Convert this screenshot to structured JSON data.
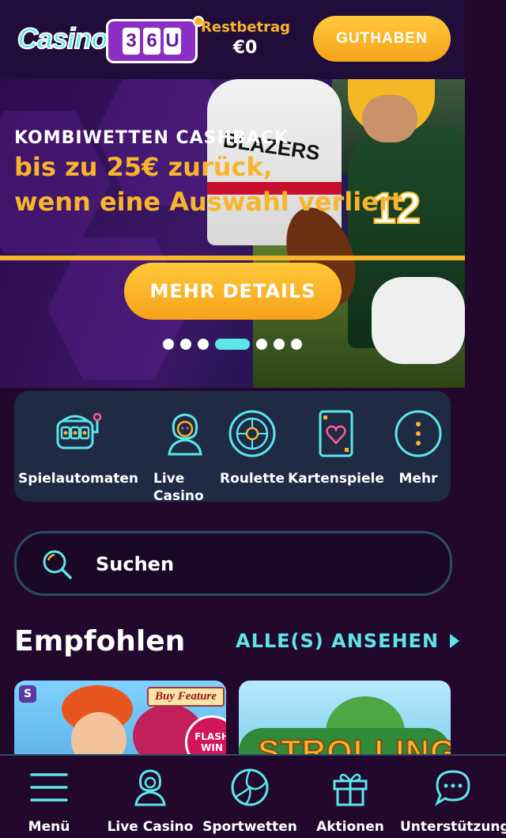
{
  "header": {
    "logo_text": "Casino",
    "logo_reels": [
      "3",
      "6",
      "U"
    ],
    "balance_label": "Restbetrag",
    "balance_value": "€0",
    "deposit_button": "GUTHABEN"
  },
  "banner": {
    "kicker": "KOMBIWETTEN CASHBACK",
    "headline_line1": "bis zu 25€ zurück,",
    "headline_line2": "wenn eine Auswahl verliert",
    "cta": "MEHR DETAILS",
    "slides_total": 7,
    "active_slide": 4,
    "jersey_text_1": "BLAZERS",
    "jersey_number_2": "12"
  },
  "categories": [
    {
      "label": "Spielautomaten",
      "icon": "slot-machine-icon"
    },
    {
      "label": "Live Casino",
      "icon": "live-dealer-icon"
    },
    {
      "label": "Roulette",
      "icon": "roulette-icon"
    },
    {
      "label": "Kartenspiele",
      "icon": "card-heart-icon"
    },
    {
      "label": "Mehr",
      "icon": "more-dots-icon"
    }
  ],
  "search": {
    "placeholder": "Suchen"
  },
  "featured": {
    "title": "Empfohlen",
    "see_all": "ALLE(S) ANSEHEN",
    "games": [
      {
        "badge": "Buy Feature",
        "sticker": "FLASH WIN",
        "provider_mark": "S"
      },
      {
        "title": "STROLLING"
      }
    ]
  },
  "bottom_nav": [
    {
      "label": "Menü",
      "icon": "hamburger-menu-icon"
    },
    {
      "label": "Live Casino",
      "icon": "live-dealer-icon"
    },
    {
      "label": "Sportwetten",
      "icon": "volleyball-icon"
    },
    {
      "label": "Aktionen",
      "icon": "gift-icon"
    },
    {
      "label": "Unterstützung",
      "icon": "chat-bubble-icon"
    }
  ],
  "colors": {
    "background": "#22082d",
    "accent_gold": "#f7b52b",
    "accent_cyan": "#5ce6ea",
    "panel": "#1f2a45"
  }
}
